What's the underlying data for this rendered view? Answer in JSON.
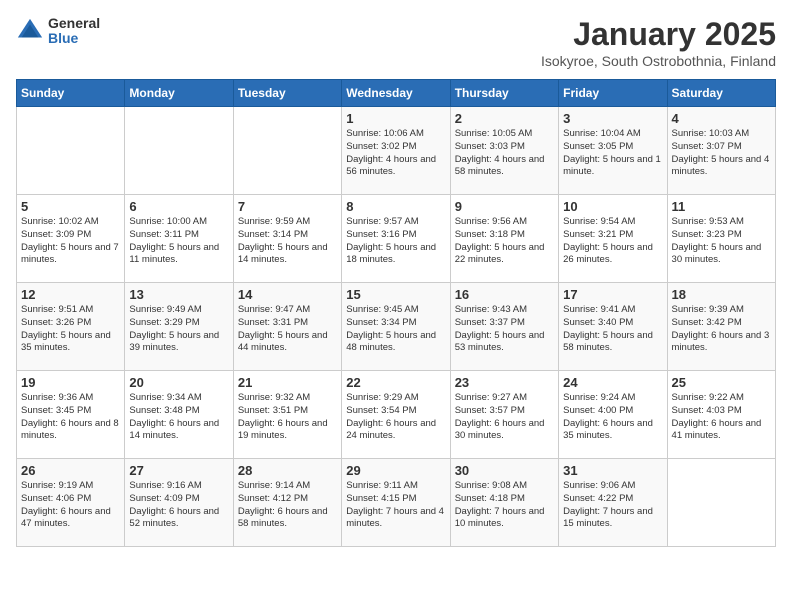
{
  "logo": {
    "general": "General",
    "blue": "Blue"
  },
  "title": "January 2025",
  "subtitle": "Isokyroe, South Ostrobothnia, Finland",
  "days_of_week": [
    "Sunday",
    "Monday",
    "Tuesday",
    "Wednesday",
    "Thursday",
    "Friday",
    "Saturday"
  ],
  "weeks": [
    [
      {
        "day": "",
        "info": ""
      },
      {
        "day": "",
        "info": ""
      },
      {
        "day": "",
        "info": ""
      },
      {
        "day": "1",
        "info": "Sunrise: 10:06 AM\nSunset: 3:02 PM\nDaylight: 4 hours and 56 minutes."
      },
      {
        "day": "2",
        "info": "Sunrise: 10:05 AM\nSunset: 3:03 PM\nDaylight: 4 hours and 58 minutes."
      },
      {
        "day": "3",
        "info": "Sunrise: 10:04 AM\nSunset: 3:05 PM\nDaylight: 5 hours and 1 minute."
      },
      {
        "day": "4",
        "info": "Sunrise: 10:03 AM\nSunset: 3:07 PM\nDaylight: 5 hours and 4 minutes."
      }
    ],
    [
      {
        "day": "5",
        "info": "Sunrise: 10:02 AM\nSunset: 3:09 PM\nDaylight: 5 hours and 7 minutes."
      },
      {
        "day": "6",
        "info": "Sunrise: 10:00 AM\nSunset: 3:11 PM\nDaylight: 5 hours and 11 minutes."
      },
      {
        "day": "7",
        "info": "Sunrise: 9:59 AM\nSunset: 3:14 PM\nDaylight: 5 hours and 14 minutes."
      },
      {
        "day": "8",
        "info": "Sunrise: 9:57 AM\nSunset: 3:16 PM\nDaylight: 5 hours and 18 minutes."
      },
      {
        "day": "9",
        "info": "Sunrise: 9:56 AM\nSunset: 3:18 PM\nDaylight: 5 hours and 22 minutes."
      },
      {
        "day": "10",
        "info": "Sunrise: 9:54 AM\nSunset: 3:21 PM\nDaylight: 5 hours and 26 minutes."
      },
      {
        "day": "11",
        "info": "Sunrise: 9:53 AM\nSunset: 3:23 PM\nDaylight: 5 hours and 30 minutes."
      }
    ],
    [
      {
        "day": "12",
        "info": "Sunrise: 9:51 AM\nSunset: 3:26 PM\nDaylight: 5 hours and 35 minutes."
      },
      {
        "day": "13",
        "info": "Sunrise: 9:49 AM\nSunset: 3:29 PM\nDaylight: 5 hours and 39 minutes."
      },
      {
        "day": "14",
        "info": "Sunrise: 9:47 AM\nSunset: 3:31 PM\nDaylight: 5 hours and 44 minutes."
      },
      {
        "day": "15",
        "info": "Sunrise: 9:45 AM\nSunset: 3:34 PM\nDaylight: 5 hours and 48 minutes."
      },
      {
        "day": "16",
        "info": "Sunrise: 9:43 AM\nSunset: 3:37 PM\nDaylight: 5 hours and 53 minutes."
      },
      {
        "day": "17",
        "info": "Sunrise: 9:41 AM\nSunset: 3:40 PM\nDaylight: 5 hours and 58 minutes."
      },
      {
        "day": "18",
        "info": "Sunrise: 9:39 AM\nSunset: 3:42 PM\nDaylight: 6 hours and 3 minutes."
      }
    ],
    [
      {
        "day": "19",
        "info": "Sunrise: 9:36 AM\nSunset: 3:45 PM\nDaylight: 6 hours and 8 minutes."
      },
      {
        "day": "20",
        "info": "Sunrise: 9:34 AM\nSunset: 3:48 PM\nDaylight: 6 hours and 14 minutes."
      },
      {
        "day": "21",
        "info": "Sunrise: 9:32 AM\nSunset: 3:51 PM\nDaylight: 6 hours and 19 minutes."
      },
      {
        "day": "22",
        "info": "Sunrise: 9:29 AM\nSunset: 3:54 PM\nDaylight: 6 hours and 24 minutes."
      },
      {
        "day": "23",
        "info": "Sunrise: 9:27 AM\nSunset: 3:57 PM\nDaylight: 6 hours and 30 minutes."
      },
      {
        "day": "24",
        "info": "Sunrise: 9:24 AM\nSunset: 4:00 PM\nDaylight: 6 hours and 35 minutes."
      },
      {
        "day": "25",
        "info": "Sunrise: 9:22 AM\nSunset: 4:03 PM\nDaylight: 6 hours and 41 minutes."
      }
    ],
    [
      {
        "day": "26",
        "info": "Sunrise: 9:19 AM\nSunset: 4:06 PM\nDaylight: 6 hours and 47 minutes."
      },
      {
        "day": "27",
        "info": "Sunrise: 9:16 AM\nSunset: 4:09 PM\nDaylight: 6 hours and 52 minutes."
      },
      {
        "day": "28",
        "info": "Sunrise: 9:14 AM\nSunset: 4:12 PM\nDaylight: 6 hours and 58 minutes."
      },
      {
        "day": "29",
        "info": "Sunrise: 9:11 AM\nSunset: 4:15 PM\nDaylight: 7 hours and 4 minutes."
      },
      {
        "day": "30",
        "info": "Sunrise: 9:08 AM\nSunset: 4:18 PM\nDaylight: 7 hours and 10 minutes."
      },
      {
        "day": "31",
        "info": "Sunrise: 9:06 AM\nSunset: 4:22 PM\nDaylight: 7 hours and 15 minutes."
      },
      {
        "day": "",
        "info": ""
      }
    ]
  ]
}
